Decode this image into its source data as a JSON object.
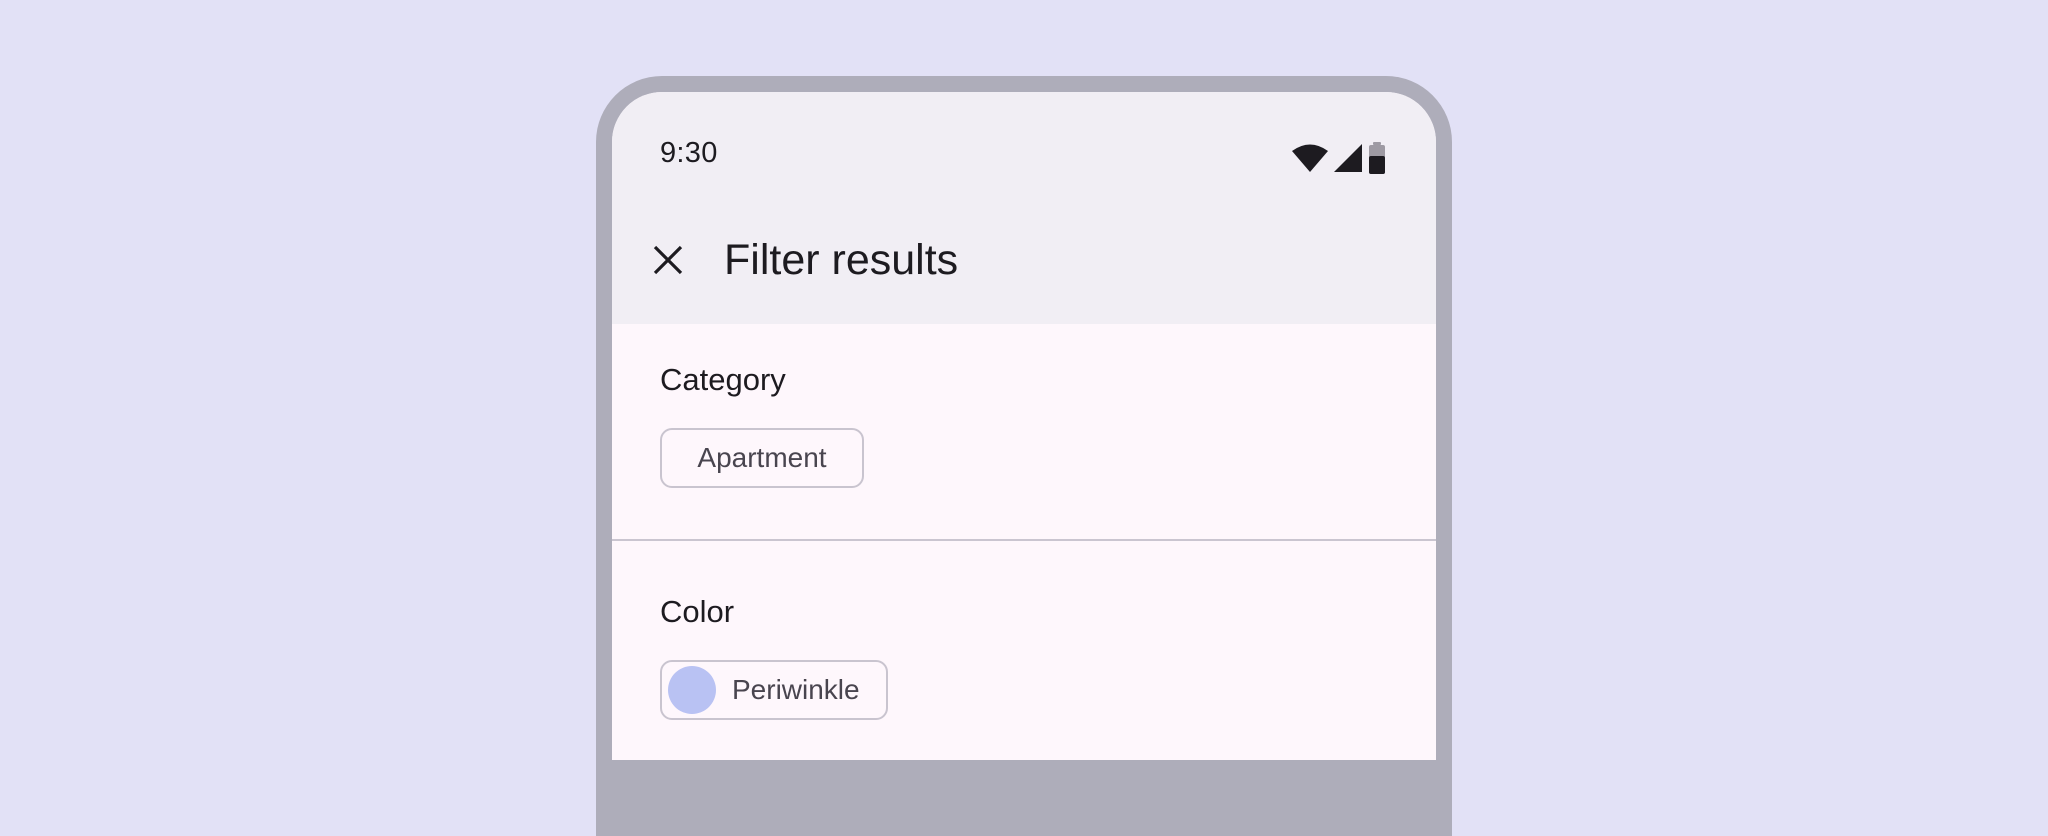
{
  "status_bar": {
    "time": "9:30",
    "icons": [
      "wifi-icon",
      "cell-signal-icon",
      "battery-icon"
    ]
  },
  "app_bar": {
    "close_icon": "close-icon",
    "title": "Filter results"
  },
  "sections": {
    "category": {
      "title": "Category",
      "chip_label": "Apartment"
    },
    "color": {
      "title": "Color",
      "chip_label": "Periwinkle",
      "swatch_color": "#b9c2f3"
    }
  },
  "colors": {
    "background": "#e2e1f6",
    "device_frame": "#aeadba",
    "top_app_bar": "#f1eef4",
    "surface": "#fef7fc",
    "outline": "#c9c4cf",
    "on_surface": "#1d1b20",
    "on_surface_variant": "#49454f"
  }
}
